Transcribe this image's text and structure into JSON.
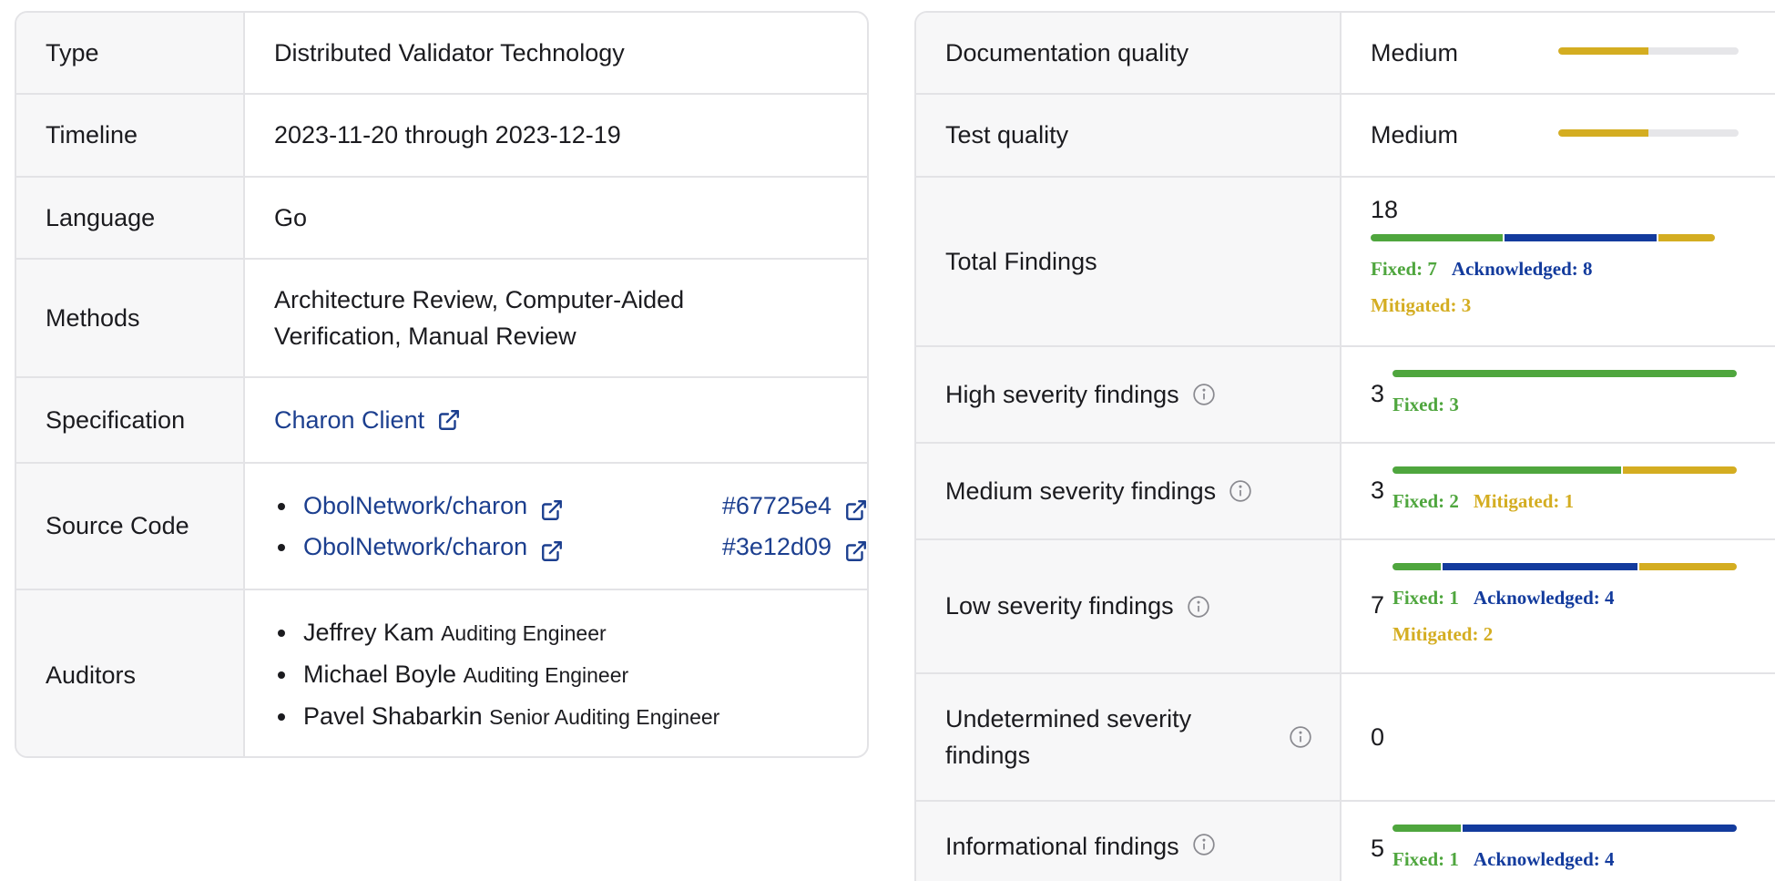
{
  "audit_info": {
    "type": {
      "label": "Type",
      "value": "Distributed Validator Technology"
    },
    "timeline": {
      "label": "Timeline",
      "value": "2023-11-20 through 2023-12-19"
    },
    "language": {
      "label": "Language",
      "value": "Go"
    },
    "methods": {
      "label": "Methods",
      "line1": "Architecture Review, Computer-Aided",
      "line2": "Verification, Manual Review"
    },
    "specification": {
      "label": "Specification",
      "link": "Charon Client"
    },
    "source_code": {
      "label": "Source Code",
      "items": [
        {
          "repo": "ObolNetwork/charon",
          "commit": "#67725e4"
        },
        {
          "repo": "ObolNetwork/charon",
          "commit": "#3e12d09"
        }
      ]
    },
    "auditors": {
      "label": "Auditors",
      "items": [
        {
          "name": "Jeffrey Kam",
          "role": "Auditing Engineer"
        },
        {
          "name": "Michael Boyle",
          "role": "Auditing Engineer"
        },
        {
          "name": "Pavel Shabarkin",
          "role": "Senior Auditing Engineer"
        }
      ]
    }
  },
  "quality": {
    "documentation": {
      "label": "Documentation quality",
      "value": "Medium",
      "level": 0.5
    },
    "test": {
      "label": "Test quality",
      "value": "Medium",
      "level": 0.5
    }
  },
  "findings": {
    "total": {
      "label": "Total Findings",
      "count": "18",
      "fixed": 7,
      "acknowledged": 8,
      "mitigated": 3,
      "fixed_text": "Fixed: 7",
      "ack_text": "Acknowledged: 8",
      "mit_text": "Mitigated: 3"
    },
    "high": {
      "label": "High severity findings",
      "count": "3",
      "fixed": 3,
      "acknowledged": 0,
      "mitigated": 0,
      "fixed_text": "Fixed: 3"
    },
    "medium": {
      "label": "Medium severity findings",
      "count": "3",
      "fixed": 2,
      "acknowledged": 0,
      "mitigated": 1,
      "fixed_text": "Fixed: 2",
      "mit_text": "Mitigated: 1"
    },
    "low": {
      "label": "Low severity findings",
      "count": "7",
      "fixed": 1,
      "acknowledged": 4,
      "mitigated": 2,
      "fixed_text": "Fixed: 1",
      "ack_text": "Acknowledged: 4",
      "mit_text": "Mitigated: 2"
    },
    "undetermined": {
      "label_line1": "Undetermined severity",
      "label_line2": "findings",
      "count": "0"
    },
    "informational": {
      "label": "Informational findings",
      "count": "5",
      "fixed": 1,
      "acknowledged": 4,
      "mitigated": 0,
      "fixed_text": "Fixed: 1",
      "ack_text": "Acknowledged: 4"
    }
  },
  "colors": {
    "fixed": "#4fa63e",
    "acknowledged": "#133b9d",
    "mitigated": "#d4ad21",
    "link": "#1c3f8f"
  },
  "icons": {
    "external_link": "external-link-icon",
    "info": "info-icon"
  }
}
